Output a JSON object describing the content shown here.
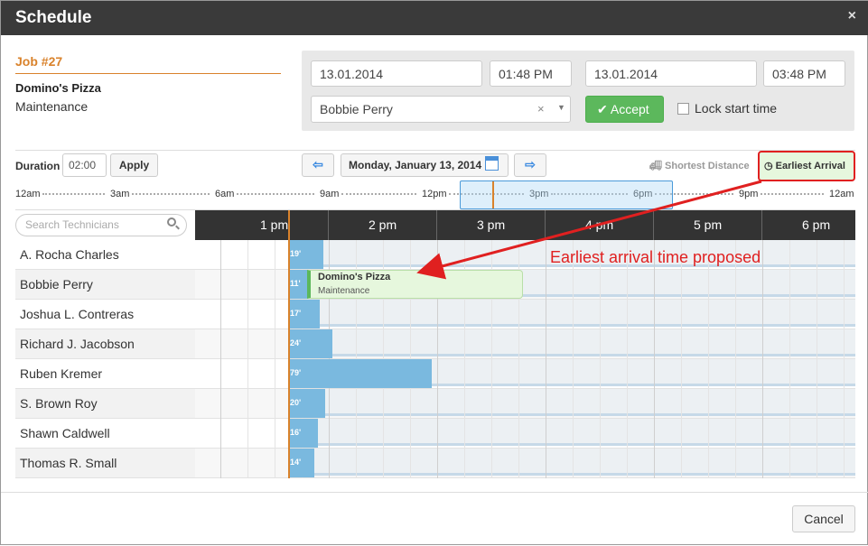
{
  "dialog": {
    "title": "Schedule",
    "close_glyph": "×"
  },
  "job": {
    "id": "Job #27",
    "customer": "Domino's Pizza",
    "type": "Maintenance"
  },
  "form": {
    "start_date": "13.01.2014",
    "start_time": "01:48 PM",
    "end_date": "13.01.2014",
    "end_time": "03:48 PM",
    "technician": "Bobbie Perry",
    "clear_glyph": "×",
    "caret_glyph": "▼",
    "accept_label": "Accept",
    "accept_check": "✔",
    "lock_label": "Lock start time"
  },
  "toolbar": {
    "duration_label": "Duration",
    "duration_value": "02:00",
    "apply_label": "Apply",
    "prev_glyph": "⇦",
    "next_glyph": "⇨",
    "date_label": "Monday, January 13, 2014",
    "shortest_label": "Shortest Distance",
    "shortest_icon": "truck-icon",
    "earliest_label": "Earliest Arrival",
    "earliest_icon": "clock-icon"
  },
  "overview_labels": [
    "12am",
    "3am",
    "6am",
    "9am",
    "12pm",
    "3pm",
    "6pm",
    "9pm",
    "12am"
  ],
  "search": {
    "placeholder": "Search Technicians"
  },
  "timeline": {
    "hours": [
      "1 pm",
      "2 pm",
      "3 pm",
      "4 pm",
      "5 pm",
      "6 pm"
    ]
  },
  "technicians": [
    {
      "name": "A. Rocha Charles",
      "travel": "19'"
    },
    {
      "name": "Bobbie Perry",
      "travel": "11'"
    },
    {
      "name": "Joshua L. Contreras",
      "travel": "17'"
    },
    {
      "name": "Richard J. Jacobson",
      "travel": "24'"
    },
    {
      "name": "Ruben Kremer",
      "travel": "79'"
    },
    {
      "name": "S. Brown Roy",
      "travel": "20'"
    },
    {
      "name": "Shawn Caldwell",
      "travel": "16'"
    },
    {
      "name": "Thomas R. Small",
      "travel": "14'"
    }
  ],
  "scheduled_job": {
    "name": "Domino's Pizza",
    "type": "Maintenance"
  },
  "annotation": "Earliest arrival time proposed",
  "footer": {
    "cancel_label": "Cancel"
  },
  "colors": {
    "accent": "#d9822b",
    "accept": "#5cb85c",
    "annotation": "#e02020",
    "travel": "#7ab9df"
  }
}
